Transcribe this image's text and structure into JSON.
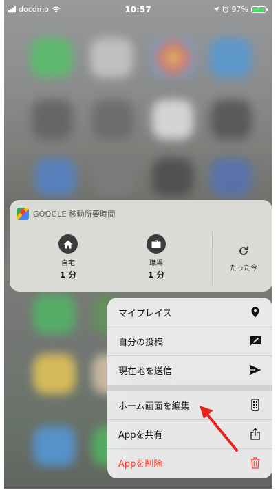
{
  "status_bar": {
    "carrier": "docomo",
    "time": "10:57",
    "battery": "97%"
  },
  "widget": {
    "title": "GOOGLE 移動所要時間",
    "destinations": [
      {
        "name": "自宅",
        "duration": "1 分",
        "icon": "home-icon"
      },
      {
        "name": "職場",
        "duration": "1 分",
        "icon": "briefcase-icon"
      }
    ],
    "refresh_label": "たった今"
  },
  "menu": {
    "items": [
      {
        "label": "マイプレイス",
        "icon": "location-pin-icon"
      },
      {
        "label": "自分の投稿",
        "icon": "edit-icon"
      },
      {
        "label": "現在地を送信",
        "icon": "send-icon"
      },
      {
        "label": "ホーム画面を編集",
        "icon": "phone-edit-icon"
      },
      {
        "label": "Appを共有",
        "icon": "share-icon"
      },
      {
        "label": "Appを削除",
        "icon": "trash-icon"
      }
    ]
  },
  "colors": {
    "danger": "#ff3b30",
    "annotation_arrow": "#e8221c",
    "battery_fill": "#4cd964"
  }
}
